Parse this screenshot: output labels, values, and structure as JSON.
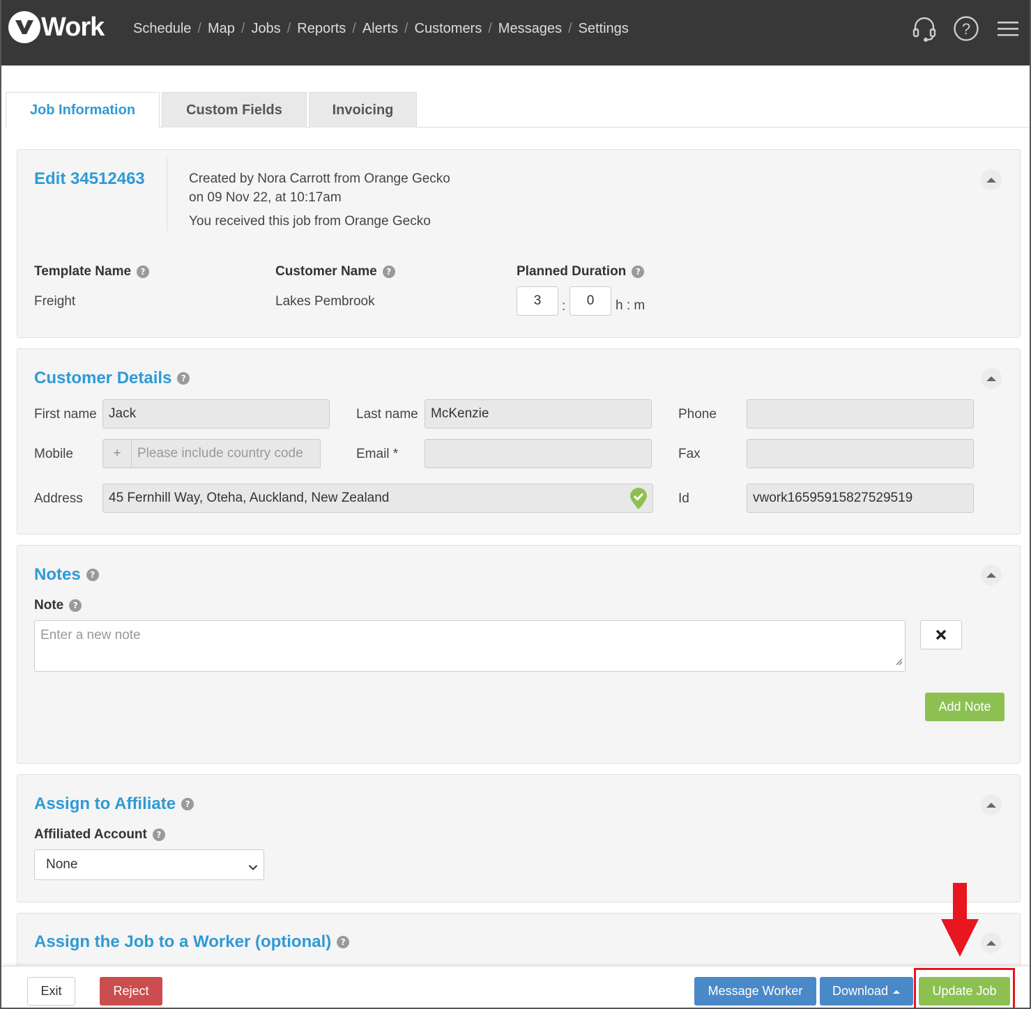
{
  "app": {
    "logo_text": "Work",
    "nav": [
      "Schedule",
      "Map",
      "Jobs",
      "Reports",
      "Alerts",
      "Customers",
      "Messages",
      "Settings"
    ]
  },
  "tabs": [
    {
      "label": "Job Information",
      "active": true
    },
    {
      "label": "Custom Fields",
      "active": false
    },
    {
      "label": "Invoicing",
      "active": false
    }
  ],
  "job": {
    "title": "Edit 34512463",
    "created_line1": "Created by Nora Carrott from Orange Gecko",
    "created_line2": "on 09 Nov 22, at 10:17am",
    "received": "You received this job from Orange Gecko",
    "template_label": "Template Name",
    "template_value": "Freight",
    "customer_label": "Customer Name",
    "customer_value": "Lakes Pembrook",
    "duration_label": "Planned Duration",
    "duration_hours": "3",
    "duration_minutes": "0",
    "duration_sep": ":",
    "duration_unit": "h : m"
  },
  "customer_details": {
    "title": "Customer Details",
    "first_name_label": "First name",
    "first_name": "Jack",
    "last_name_label": "Last name",
    "last_name": "McKenzie",
    "phone_label": "Phone",
    "phone": "",
    "mobile_label": "Mobile",
    "mobile_prefix": "+",
    "mobile_placeholder": "Please include country code",
    "email_label": "Email *",
    "email": "",
    "fax_label": "Fax",
    "fax": "",
    "address_label": "Address",
    "address": "45 Fernhill Way, Oteha, Auckland, New Zealand",
    "id_label": "Id",
    "id": "vwork16595915827529519"
  },
  "notes": {
    "title": "Notes",
    "note_label": "Note",
    "placeholder": "Enter a new note",
    "add_label": "Add Note"
  },
  "affiliate": {
    "title": "Assign to Affiliate",
    "account_label": "Affiliated Account",
    "selected": "None"
  },
  "worker": {
    "title": "Assign the Job to a Worker (optional)"
  },
  "footer": {
    "exit": "Exit",
    "reject": "Reject",
    "message_worker": "Message Worker",
    "download": "Download",
    "update_job": "Update Job"
  },
  "colors": {
    "accent": "#2f9ad5",
    "green": "#8cc152",
    "blue": "#4a89c8",
    "red": "#cc4d4d",
    "highlight": "#e8161e"
  }
}
